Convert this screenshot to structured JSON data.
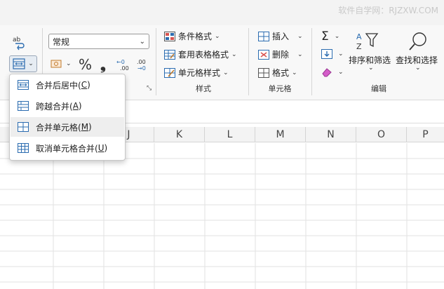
{
  "watermark": "软件自学网：RJZXW.COM",
  "ribbon": {
    "number_format": {
      "value": "常规"
    },
    "percent_symbol": "%",
    "comma_symbol": "❟",
    "decimal_increase": "←0 .00",
    "decimal_decrease": ".00 →0",
    "styles": {
      "conditional_format": "条件格式",
      "table_format": "套用表格格式",
      "cell_style": "单元格样式",
      "group_label": "样式"
    },
    "cells": {
      "insert": "插入",
      "delete": "删除",
      "format": "格式",
      "group_label": "单元格"
    },
    "editing": {
      "sum_symbol": "Σ",
      "sort_filter": "排序和筛选",
      "find_select": "查找和选择",
      "group_label": "编辑"
    }
  },
  "merge_menu": {
    "items": [
      {
        "label": "合并后居中(",
        "key": "C",
        "close": ")"
      },
      {
        "label": "跨越合并(",
        "key": "A",
        "close": ")"
      },
      {
        "label": "合并单元格(",
        "key": "M",
        "close": ")"
      },
      {
        "label": "取消单元格合并(",
        "key": "U",
        "close": ")"
      }
    ]
  },
  "columns": [
    "J",
    "K",
    "L",
    "M",
    "N",
    "O",
    "P"
  ],
  "colors": {
    "accent_blue": "#2b6cb0",
    "menu_hover": "#eeeeee",
    "header_bg": "#f3f3f3",
    "grid_line": "#e2e2e2"
  }
}
